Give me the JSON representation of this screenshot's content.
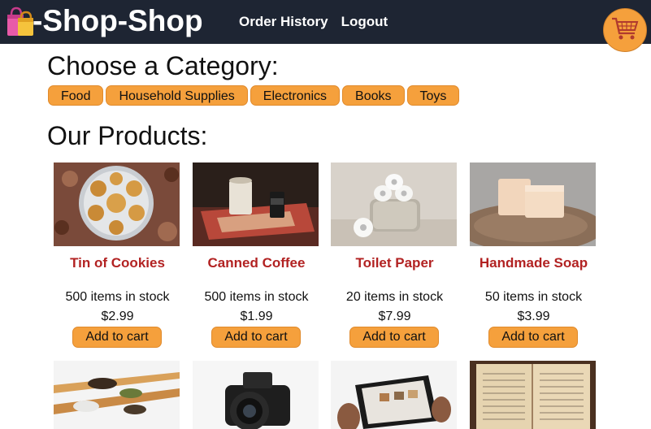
{
  "header": {
    "brand": "-Shop-Shop",
    "nav": [
      "Order History",
      "Logout"
    ],
    "brand_icon": "shopping-bags-icon",
    "cart_icon": "shopping-cart-icon"
  },
  "categories": {
    "title": "Choose a Category:",
    "items": [
      "Food",
      "Household Supplies",
      "Electronics",
      "Books",
      "Toys"
    ]
  },
  "products": {
    "title": "Our Products:",
    "add_label": "Add to cart",
    "items": [
      {
        "name": "Tin of Cookies",
        "stock": "500 items in stock",
        "price": "$2.99"
      },
      {
        "name": "Canned Coffee",
        "stock": "500 items in stock",
        "price": "$1.99"
      },
      {
        "name": "Toilet Paper",
        "stock": "20 items in stock",
        "price": "$7.99"
      },
      {
        "name": "Handmade Soap",
        "stock": "50 items in stock",
        "price": "$3.99"
      }
    ]
  },
  "colors": {
    "accent": "#f5a03c",
    "header_bg": "#1e2533",
    "product_name": "#b22222"
  }
}
